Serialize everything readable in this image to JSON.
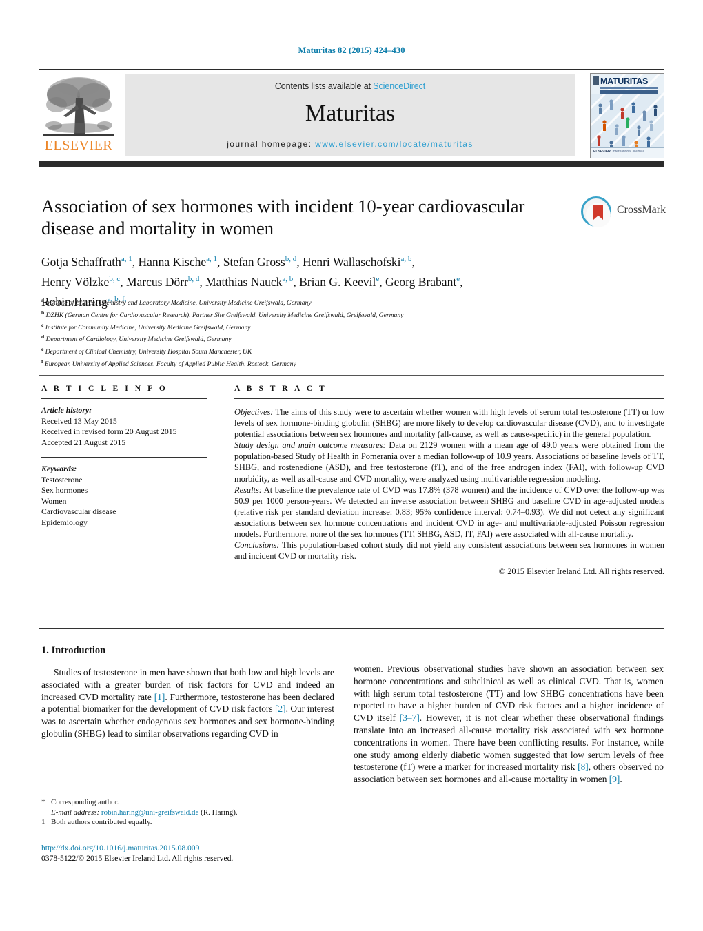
{
  "running_head": "Maturitas 82 (2015) 424–430",
  "masthead": {
    "publisher_name": "ELSEVIER",
    "contents_prefix": "Contents lists available at ",
    "contents_link": "ScienceDirect",
    "journal_name": "Maturitas",
    "homepage_prefix": "journal homepage: ",
    "homepage_url": "www.elsevier.com/locate/maturitas",
    "cover_title": "MATURITAS",
    "cover_elsevier": "ELSEVIER",
    "cover_footer": "An International Journal"
  },
  "article": {
    "title": "Association of sex hormones with incident 10-year cardiovascular disease and mortality in women",
    "crossmark_label": "CrossMark"
  },
  "authors": {
    "line1": [
      {
        "name": "Gotja Schaffrath",
        "marks": "a, 1",
        "sep": ", "
      },
      {
        "name": "Hanna Kische",
        "marks": "a, 1",
        "sep": ", "
      },
      {
        "name": "Stefan Gross",
        "marks": "b, d",
        "sep": ", "
      },
      {
        "name": "Henri Wallaschofski",
        "marks": "a, b",
        "sep": ","
      }
    ],
    "line2": [
      {
        "name": "Henry Völzke",
        "marks": "b, c",
        "sep": ", "
      },
      {
        "name": "Marcus Dörr",
        "marks": "b, d",
        "sep": ", "
      },
      {
        "name": "Matthias Nauck",
        "marks": "a, b",
        "sep": ", "
      },
      {
        "name": "Brian G. Keevil",
        "marks": "e",
        "sep": ", "
      },
      {
        "name": "Georg Brabant",
        "marks": "e",
        "sep": ","
      }
    ],
    "line3": [
      {
        "name": "Robin Haring",
        "marks": "a, b, f,",
        "sep": ""
      }
    ]
  },
  "affiliations": [
    {
      "mark": "a",
      "text": "Institute of Clinical Chemistry and Laboratory Medicine, University Medicine Greifswald, Germany"
    },
    {
      "mark": "b",
      "text": "DZHK (German Centre for Cardiovascular Research), Partner Site Greifswald, University Medicine Greifswald, Greifswald, Germany"
    },
    {
      "mark": "c",
      "text": "Institute for Community Medicine, University Medicine Greifswald, Germany"
    },
    {
      "mark": "d",
      "text": "Department of Cardiology, University Medicine Greifswald, Germany"
    },
    {
      "mark": "e",
      "text": "Department of Clinical Chemistry, University Hospital South Manchester, UK"
    },
    {
      "mark": "f",
      "text": "European University of Applied Sciences, Faculty of Applied Public Health, Rostock, Germany"
    }
  ],
  "article_info": {
    "heading": "A R T I C L E   I N F O",
    "history_label": "Article history:",
    "history": [
      "Received 13 May 2015",
      "Received in revised form 20 August 2015",
      "Accepted 21 August 2015"
    ],
    "keywords_label": "Keywords:",
    "keywords": [
      "Testosterone",
      "Sex hormones",
      "Women",
      "Cardiovascular disease",
      "Epidemiology"
    ]
  },
  "abstract": {
    "heading": "A B S T R A C T",
    "sections": [
      {
        "label": "Objectives:",
        "text": " The aims of this study were to ascertain whether women with high levels of serum total testosterone (TT) or low levels of sex hormone-binding globulin (SHBG) are more likely to develop cardiovascular disease (CVD), and to investigate potential associations between sex hormones and mortality (all-cause, as well as cause-specific) in the general population."
      },
      {
        "label": "Study design and main outcome measures:",
        "text": " Data on 2129 women with a mean age of 49.0 years were obtained from the population-based Study of Health in Pomerania over a median follow-up of 10.9 years. Associations of baseline levels of TT, SHBG, and rostenedione (ASD), and free testosterone (fT), and of the free androgen index (FAI), with follow-up CVD morbidity, as well as all-cause and CVD mortality, were analyzed using multivariable regression modeling."
      },
      {
        "label": "Results:",
        "text": " At baseline the prevalence rate of CVD was 17.8% (378 women) and the incidence of CVD over the follow-up was 50.9 per 1000 person-years. We detected an inverse association between SHBG and baseline CVD in age-adjusted models (relative risk per standard deviation increase: 0.83; 95% confidence interval: 0.74–0.93). We did not detect any significant associations between sex hormone concentrations and incident CVD in age- and multivariable-adjusted Poisson regression models. Furthermore, none of the sex hormones (TT, SHBG, ASD, fT, FAI) were associated with all-cause mortality."
      },
      {
        "label": "Conclusions:",
        "text": " This population-based cohort study did not yield any consistent associations between sex hormones in women and incident CVD or mortality risk."
      }
    ],
    "copyright": "© 2015 Elsevier Ireland Ltd. All rights reserved."
  },
  "introduction": {
    "heading": "1.  Introduction",
    "left_paragraph_parts": [
      {
        "t": "Studies of testosterone in men have shown that both low and high levels are associated with a greater burden of risk factors for CVD and indeed an increased CVD mortality rate "
      },
      {
        "ref": "[1]"
      },
      {
        "t": ". Furthermore, testosterone has been declared a potential biomarker for the development of CVD risk factors "
      },
      {
        "ref": "[2]"
      },
      {
        "t": ". Our interest was to ascertain whether endogenous sex hormones and sex hormone-binding globulin (SHBG) lead to similar observations regarding CVD in"
      }
    ],
    "right_paragraph_parts": [
      {
        "t": "women. Previous observational studies have shown an association between sex hormone concentrations and subclinical as well as clinical CVD. That is, women with high serum total testosterone (TT) and low SHBG concentrations have been reported to have a higher burden of CVD risk factors and a higher incidence of CVD itself "
      },
      {
        "ref": "[3–7]"
      },
      {
        "t": ". However, it is not clear whether these observational findings translate into an increased all-cause mortality risk associated with sex hormone concentrations in women. There have been conflicting results. For instance, while one study among elderly diabetic women suggested that low serum levels of free testosterone (fT) were a marker for increased mortality risk "
      },
      {
        "ref": "[8]"
      },
      {
        "t": ", others observed no association between sex hormones and all-cause mortality in women "
      },
      {
        "ref": "[9]"
      },
      {
        "t": "."
      }
    ]
  },
  "footnotes": {
    "corresponding_mark": "*",
    "corresponding_text": "Corresponding author.",
    "email_label": "E-mail address:",
    "email": "robin.haring@uni-greifswald.de",
    "email_suffix": " (R. Haring).",
    "equal_mark": "1",
    "equal_text": "Both authors contributed equally.",
    "doi": "http://dx.doi.org/10.1016/j.maturitas.2015.08.009",
    "issn_line": "0378-5122/© 2015 Elsevier Ireland Ltd. All rights reserved."
  },
  "colors": {
    "link": "#0f7eab",
    "sciencedirect": "#2f9fd0",
    "elsevier_orange": "#ec8527",
    "rule_dark": "#2b2b2b"
  }
}
